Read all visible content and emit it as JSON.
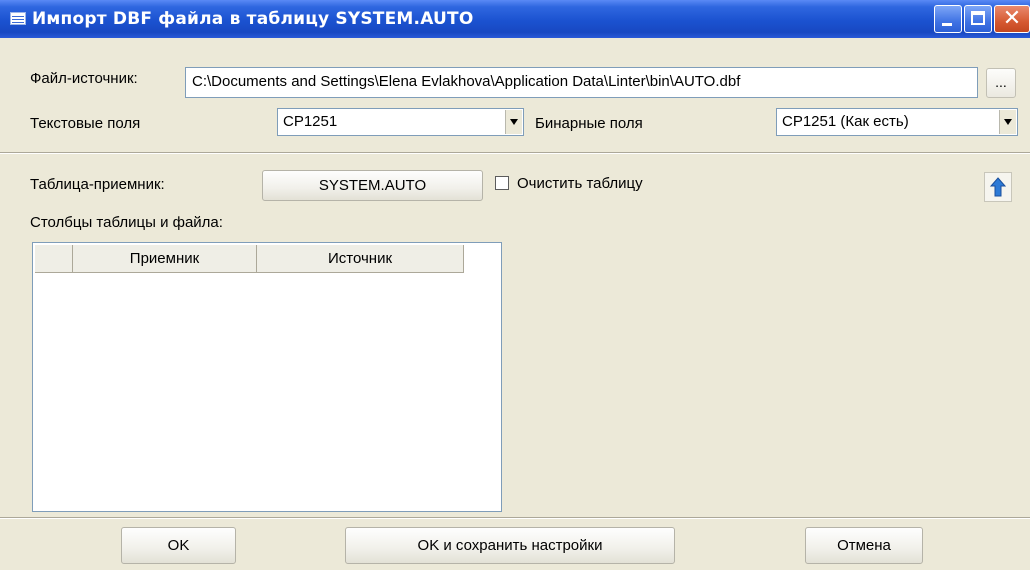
{
  "window": {
    "title": "Импорт DBF файла в таблицу SYSTEM.AUTO"
  },
  "source": {
    "label": "Файл-источник:",
    "path": "C:\\Documents and Settings\\Elena Evlakhova\\Application Data\\Linter\\bin\\AUTO.dbf",
    "browse_label": "..."
  },
  "text_fields": {
    "label": "Текстовые поля",
    "value": "CP1251"
  },
  "binary_fields": {
    "label": "Бинарные поля",
    "value": "CP1251 (Как есть)"
  },
  "target": {
    "label": "Таблица-приемник:",
    "button_label": "SYSTEM.AUTO"
  },
  "clear_table": {
    "label": "Очистить таблицу",
    "checked": false
  },
  "columns": {
    "label": "Столбцы таблицы и файла:",
    "headers": [
      "",
      "Приемник",
      "Источник"
    ],
    "rows": []
  },
  "footer": {
    "ok_label": "OK",
    "ok_save_label": "OK и сохранить настройки",
    "cancel_label": "Отмена"
  },
  "colors": {
    "titlebar": "#2f67e0",
    "window_bg": "#ece9d8",
    "close_button": "#d65a32"
  },
  "icons": [
    "table-icon",
    "minimize-icon",
    "maximize-icon",
    "close-icon",
    "dropdown-arrow-icon",
    "move-up-icon"
  ]
}
